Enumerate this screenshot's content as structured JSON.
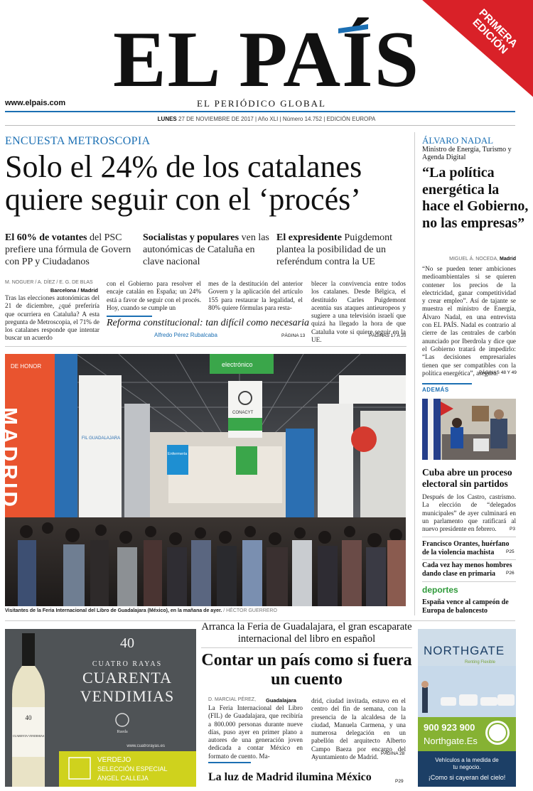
{
  "masthead": {
    "logo": "EL PAÍS",
    "url": "www.elpais.com",
    "tagline": "EL PERIÓDICO GLOBAL",
    "ribbon": "PRIMERA EDICIÓN",
    "date_day": "LUNES",
    "date_rest": "27 DE NOVIEMBRE DE 2017 | Año XLI | Número 14.752 | EDICIÓN EUROPA"
  },
  "lead": {
    "kicker": "ENCUESTA METROSCOPIA",
    "headline": "Solo el 24% de los catalanes quiere seguir con el ‘procés’",
    "sub1_bold": "El 60% de votantes",
    "sub1_rest": " del PSC prefiere una fórmula de Govern con PP y Ciudadanos",
    "sub2_bold": "Socialistas y populares",
    "sub2_rest": " ven las autonómicas de Cataluña en clave nacional",
    "sub3_bold": "El expresidente",
    "sub3_rest": " Puigdemont plantea la posibilidad de un referéndum contra la UE",
    "byline": "M. NOGUER / A. DÍEZ / E. G. DE BLAS",
    "place": "Barcelona / Madrid",
    "col1": "Tras las elecciones autonómicas del 21 de diciembre, ¿qué preferiría que ocurriera en Cataluña? A esta pregunta de Metroscopia, el 71% de los catalanes responde que intentar buscar un acuerdo",
    "col2": "con el Gobierno para resolver el encaje catalán en España; un 24% está a favor de seguir con el procés. Hoy, cuando se cumple un",
    "col3": "mes de la destitución del anterior Govern y la aplicación del artículo 155 para restaurar la legalidad, el 80% quiere fórmulas para resta-",
    "col4": "blecer la convivencia entre todos los catalanes. Desde Bélgica, el destituido Carles Puigdemont acentúa sus ataques antieuropeos y sugiere a una televisión israelí que quizá ha llegado la hora de que Cataluña vote si quiere seguir en la UE.",
    "ref": "PÁGINAS 17 A 20",
    "opinion": "Reforma constitucional: tan difícil como necesaria",
    "opinion_author": "Alfredo Pérez Rubalcaba",
    "opinion_ref": "PÁGINA 13"
  },
  "photo": {
    "caption": "Visitantes de la Feria Internacional del Libro de Guadalajara (México), en la mañana de ayer.",
    "credit": "/ HÉCTOR GUERRERO",
    "signs": {
      "madrid": "MADRID",
      "de_honor": "DE HONOR",
      "electronico": "electrónico",
      "conacyt": "CONACYT",
      "enfermeria": "Enfermería",
      "fil": "FIL GUADALAJARA"
    }
  },
  "interview": {
    "name": "ÁLVARO NADAL",
    "role": "Ministro de Energía, Turismo y Agenda Digital",
    "quote": "“La política energética la hace el Gobierno, no las empresas”",
    "byline": "MIGUEL Á. NOCEDA,",
    "place": "Madrid",
    "body": "“No se pueden tener ambiciones medioambientales si se quieren contener los precios de la electricidad, ganar competitividad y crear empleo”. Así de tajante se muestra el ministro de Energía, Álvaro Nadal, en una entrevista con EL PAÍS. Nadal es contrario al cierre de las centrales de carbón anunciado por Iberdrola y dice que el Gobierno tratará de impedirlo: “Las decisiones empresariales tienen que ser compatibles con la política energética”, asegura.",
    "ref": "PÁGINAS 48 Y 49"
  },
  "sidebar": {
    "ademas": "ADEMÁS",
    "cuba_head": "Cuba abre un proceso electoral sin partidos",
    "cuba_body": "Después de los Castro, castrismo. La elección de “delegados municipales” de ayer culminará en un parlamento que ratificará al nuevo presidente en febrero.",
    "cuba_ref": "P3",
    "brief1": "Francisco Orantes, huérfano de la violencia machista",
    "brief1_ref": "P25",
    "brief2": "Cada vez hay menos hombres dando clase en primaria",
    "brief2_ref": "P26",
    "deportes": "deportes",
    "deportes_text": "España vence al campeón de Europa de baloncesto"
  },
  "guadalajara": {
    "intro": "Arranca la Feria de Guadalajara, el gran escaparate internacional del libro en español",
    "headline": "Contar un país como si fuera un cuento",
    "byline": "D. MARCIAL PÉREZ,",
    "place": "Guadalajara",
    "col1": "La Feria Internacional del Libro (FIL) de Guadalajara, que recibiría a 800.000 personas durante nueve días, puso ayer en primer plano a autores de una generación joven dedicada a contar México en formato de cuento. Ma-",
    "col2": "drid, ciudad invitada, estuvo en el centro del fin de semana, con la presencia de la alcaldesa de la ciudad, Manuela Carmena, y una numerosa delegación en un pabellón del arquitecto Alberto Campo Baeza por encargo del Ayuntamiento de Madrid.",
    "ref": "PÁGINA 28",
    "madrid_head": "La luz de Madrid ilumina México",
    "madrid_ref": "P29"
  },
  "ads": {
    "wine": {
      "number": "40",
      "brand": "CUATRO RAYAS",
      "title1": "CUARENTA",
      "title2": "VENDIMIAS",
      "bottle_label": "CUARENTA VENDIMIAS",
      "bottle_num": "40",
      "url": "www.cuatrorayas.es",
      "verdejo": "VERDEJO",
      "line2": "SELECCIÓN ESPECIAL",
      "line3": "ÁNGEL CALLEJA",
      "rueda": "Rueda"
    },
    "northgate": {
      "brand": "NORTHGATE",
      "sub": "Renting Flexible",
      "phone": "900 923 900",
      "web": "Northgate.Es",
      "line1": "Vehículos a la medida de tu negocio.",
      "line2": "¡Como si cayeran del cielo!"
    }
  }
}
